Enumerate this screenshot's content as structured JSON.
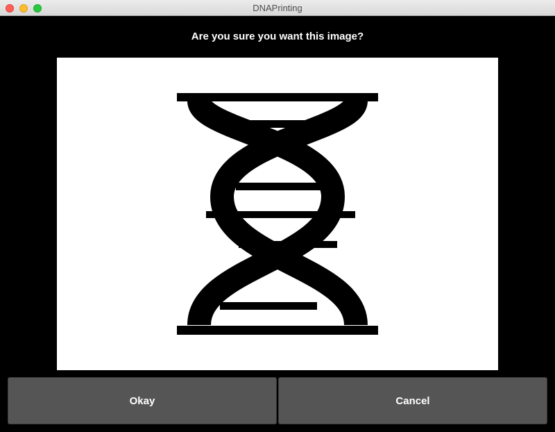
{
  "window": {
    "title": "DNAPrinting"
  },
  "dialog": {
    "prompt": "Are you sure you want this image?",
    "image_icon": "dna-double-helix-icon"
  },
  "buttons": {
    "okay_label": "Okay",
    "cancel_label": "Cancel"
  }
}
